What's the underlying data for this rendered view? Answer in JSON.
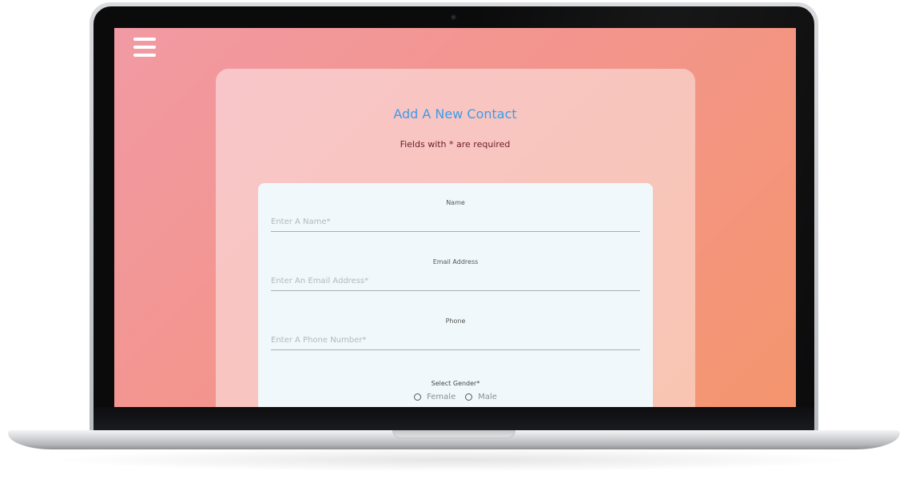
{
  "header": {
    "menu_icon": "hamburger-menu-icon"
  },
  "form": {
    "title": "Add A New Contact",
    "subtitle": "Fields with * are required",
    "fields": [
      {
        "label": "Name",
        "placeholder": "Enter A Name*"
      },
      {
        "label": "Email Address",
        "placeholder": "Enter An Email Address*"
      },
      {
        "label": "Phone",
        "placeholder": "Enter A Phone Number*"
      }
    ],
    "gender": {
      "label": "Select Gender*",
      "options": [
        "Female",
        "Male"
      ]
    }
  },
  "colors": {
    "title": "#3d9be9",
    "subtitle": "#6b1d2b",
    "gradient_start": "#f29aa4",
    "gradient_end": "#f4956e",
    "card_background": "#f0f8fb"
  }
}
